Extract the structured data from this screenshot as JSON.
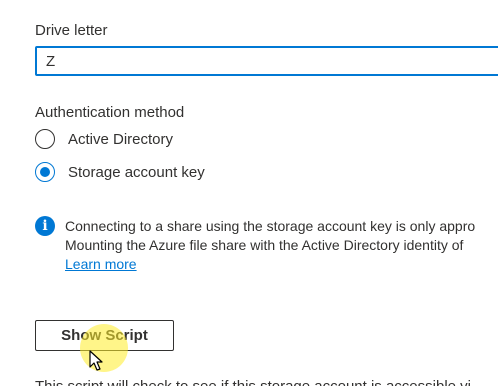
{
  "drive": {
    "label": "Drive letter",
    "value": "Z"
  },
  "authentication": {
    "label": "Authentication method",
    "options": [
      {
        "label": "Active Directory",
        "selected": false
      },
      {
        "label": "Storage account key",
        "selected": true
      }
    ]
  },
  "info": {
    "icon": "info-icon",
    "line1": "Connecting to a share using the storage account key is only appro",
    "line2": "Mounting the Azure file share with the Active Directory identity of",
    "link": "Learn more"
  },
  "actions": {
    "show_script": "Show Script"
  },
  "footer": {
    "cut_text": "This script will check to see if this storage account is accessible vi"
  },
  "colors": {
    "accent": "#0078d4",
    "text": "#323130"
  }
}
